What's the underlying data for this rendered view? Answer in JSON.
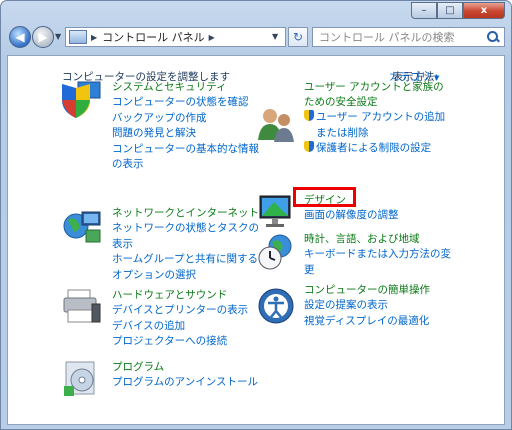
{
  "window": {
    "caption_buttons": {
      "minimize": "–",
      "maximize": "□",
      "close": "x"
    }
  },
  "address_bar": {
    "breadcrumb": "コントロール パネル",
    "refresh_glyph": "↻",
    "back_glyph": "◀",
    "forward_glyph": "▶"
  },
  "search": {
    "placeholder": "コントロール パネルの検索"
  },
  "main": {
    "heading": "コンピューターの設定を調整します",
    "view_by_label": "表示方法:",
    "view_by_value": "カテゴリ"
  },
  "categories_left": [
    {
      "title": "システムとセキュリティ",
      "icon": "shield-computer-icon",
      "links": [
        "コンピューターの状態を確認",
        "バックアップの作成",
        "問題の発見と解決",
        "コンピューターの基本的な情報",
        "の表示"
      ]
    },
    {
      "title": "ネットワークとインターネット",
      "icon": "network-globe-icon",
      "links": [
        "ネットワークの状態とタスクの",
        "表示",
        "ホームグループと共有に関する",
        "オプションの選択"
      ]
    },
    {
      "title": "ハードウェアとサウンド",
      "icon": "printer-icon",
      "links": [
        "デバイスとプリンターの表示",
        "デバイスの追加",
        "プロジェクターへの接続"
      ]
    },
    {
      "title": "プログラム",
      "icon": "program-disc-icon",
      "links": [
        "プログラムのアンインストール"
      ]
    }
  ],
  "categories_right": [
    {
      "title": "ユーザー アカウントと家族の",
      "title2": "ための安全設定",
      "icon": "users-icon",
      "links": [
        "ユーザー アカウントの追加",
        "または削除",
        "保護者による制限の設定"
      ]
    },
    {
      "title": "デザイン",
      "icon": "monitor-design-icon",
      "links": [
        "画面の解像度の調整"
      ]
    },
    {
      "title": "時計、言語、および地域",
      "icon": "clock-globe-icon",
      "links": [
        "キーボードまたは入力方法の変",
        "更"
      ]
    },
    {
      "title": "コンピューターの簡単操作",
      "icon": "ease-of-access-icon",
      "links": [
        "設定の提案の表示",
        "視覚ディスプレイの最適化"
      ]
    }
  ],
  "colors": {
    "category_title": "#0a7a16",
    "link": "#0066cc",
    "highlight": "#e00000"
  }
}
